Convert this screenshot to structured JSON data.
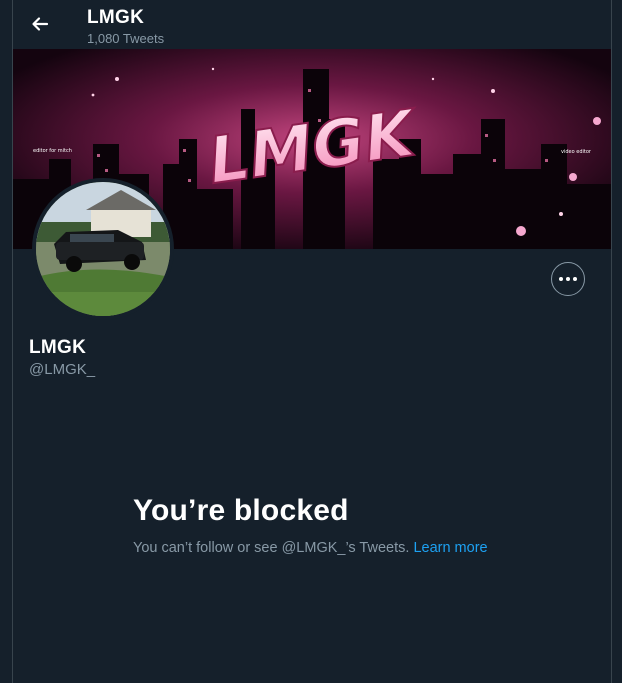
{
  "header": {
    "title": "LMGK",
    "tweet_count": "1,080 Tweets",
    "back_icon": "arrow-left-icon"
  },
  "banner": {
    "logo_text": "LMGK",
    "credit_left": "editor for mitch",
    "credit_right": "video editor"
  },
  "profile": {
    "display_name": "LMGK",
    "handle": "@LMGK_",
    "more_icon": "more-horizontal-icon"
  },
  "blocked": {
    "title": "You’re blocked",
    "message": "You can’t follow or see @LMGK_’s Tweets.",
    "learn_more": "Learn more"
  },
  "colors": {
    "background": "#15202b",
    "border": "#38444d",
    "secondary_text": "#8899a6",
    "link": "#1da1f2"
  }
}
